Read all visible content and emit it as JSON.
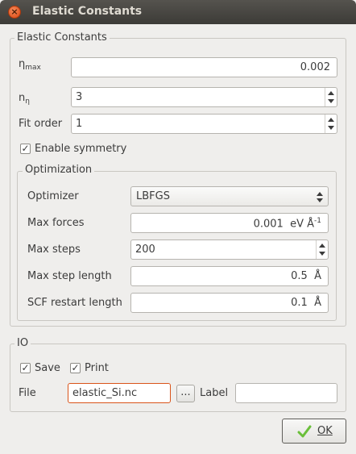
{
  "window": {
    "title": "Elastic Constants",
    "close_glyph": "×"
  },
  "elastic": {
    "group_title": "Elastic Constants",
    "eta_max": {
      "label_main": "η",
      "label_sub": "max",
      "value": "0.002"
    },
    "n_eta": {
      "label_main": "n",
      "label_sub": "η",
      "value": "3"
    },
    "fit_order": {
      "label": "Fit order",
      "value": "1"
    },
    "symmetry": {
      "label": "Enable symmetry",
      "checked": true
    }
  },
  "optimization": {
    "group_title": "Optimization",
    "optimizer": {
      "label": "Optimizer",
      "value": "LBFGS"
    },
    "max_forces": {
      "label": "Max forces",
      "value": "0.001",
      "unit_base": "eV Å",
      "unit_sup": "-1"
    },
    "max_steps": {
      "label": "Max steps",
      "value": "200"
    },
    "max_step_length": {
      "label": "Max step length",
      "value": "0.5",
      "unit": "Å"
    },
    "scf_restart_length": {
      "label": "SCF restart length",
      "value": "0.1",
      "unit": "Å"
    }
  },
  "io": {
    "group_title": "IO",
    "save": {
      "label": "Save",
      "checked": true
    },
    "print": {
      "label": "Print",
      "checked": true
    },
    "file": {
      "label": "File",
      "value": "elastic_Si.nc"
    },
    "browse_label": "...",
    "label_field": {
      "label": "Label",
      "value": ""
    }
  },
  "ok_button": {
    "label": "OK"
  },
  "colors": {
    "title_bar": "#3c3b37",
    "close_button": "#e5541a",
    "file_field_border": "#d9541a",
    "check_icon": "#6abf3a"
  }
}
